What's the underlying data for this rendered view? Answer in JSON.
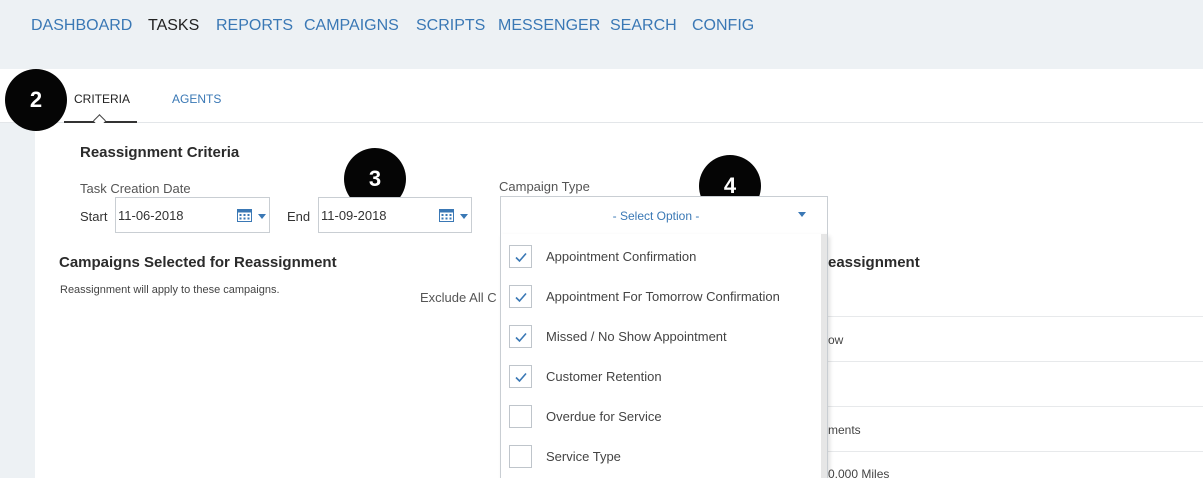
{
  "topnav": {
    "items": [
      {
        "label": "DASHBOARD"
      },
      {
        "label": "TASKS"
      },
      {
        "label": "REPORTS"
      },
      {
        "label": "CAMPAIGNS"
      },
      {
        "label": "SCRIPTS"
      },
      {
        "label": "MESSENGER"
      },
      {
        "label": "SEARCH"
      },
      {
        "label": "CONFIG"
      }
    ],
    "active": "TASKS"
  },
  "subtabs": [
    {
      "label": "CRITERIA",
      "active": true
    },
    {
      "label": "AGENTS",
      "active": false
    }
  ],
  "badges": [
    "2",
    "3",
    "4"
  ],
  "criteria": {
    "title": "Reassignment Criteria",
    "task_creation_label": "Task Creation Date",
    "start_label": "Start",
    "start_value": "11-06-2018",
    "end_label": "End",
    "end_value": "11-09-2018",
    "campaign_type_label": "Campaign Type",
    "campaign_type_placeholder": "- Select Option -"
  },
  "campaign_options": [
    {
      "label": "Appointment Confirmation",
      "checked": true
    },
    {
      "label": "Appointment For Tomorrow Confirmation",
      "checked": true
    },
    {
      "label": "Missed / No Show Appointment",
      "checked": true
    },
    {
      "label": "Customer Retention",
      "checked": true
    },
    {
      "label": "Overdue for Service",
      "checked": false
    },
    {
      "label": "Service Type",
      "checked": false
    }
  ],
  "selected_section": {
    "title": "Campaigns Selected for Reassignment",
    "description": "Reassignment will apply to these campaigns.",
    "exclude_text": "Exclude All C"
  },
  "right_section": {
    "title_fragment": "eassignment",
    "rows": [
      "ow",
      "",
      "ments",
      "0,000 Miles"
    ]
  },
  "colors": {
    "accent": "#3a78b5",
    "nav_bg": "#edf1f4",
    "badge": "#050505"
  }
}
